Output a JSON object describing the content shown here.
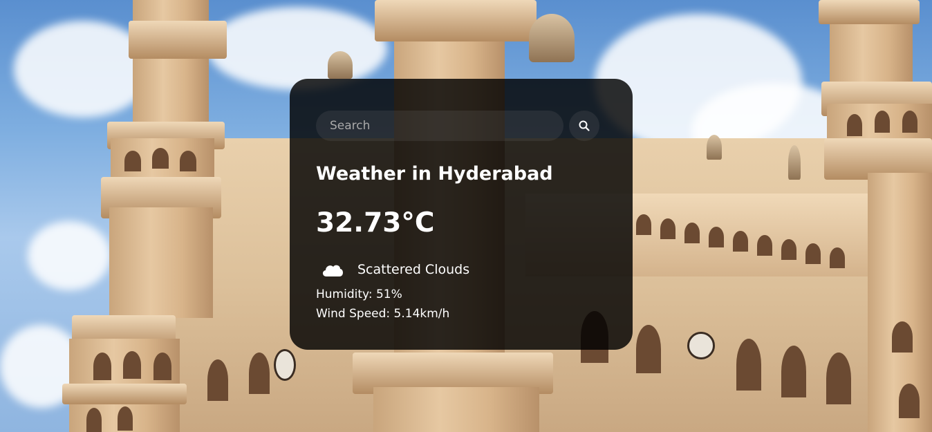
{
  "search": {
    "placeholder": "Search",
    "value": "",
    "button_icon": "search-icon"
  },
  "weather": {
    "city_heading": "Weather in Hyderabad",
    "temperature": "32.73°C",
    "condition_icon": "cloud-icon",
    "condition": "Scattered Clouds",
    "humidity": "Humidity: 51%",
    "wind_speed": "Wind Speed: 5.14km/h"
  },
  "colors": {
    "card_background": "#000000",
    "text": "#ffffff",
    "placeholder": "#a9a9a9"
  }
}
